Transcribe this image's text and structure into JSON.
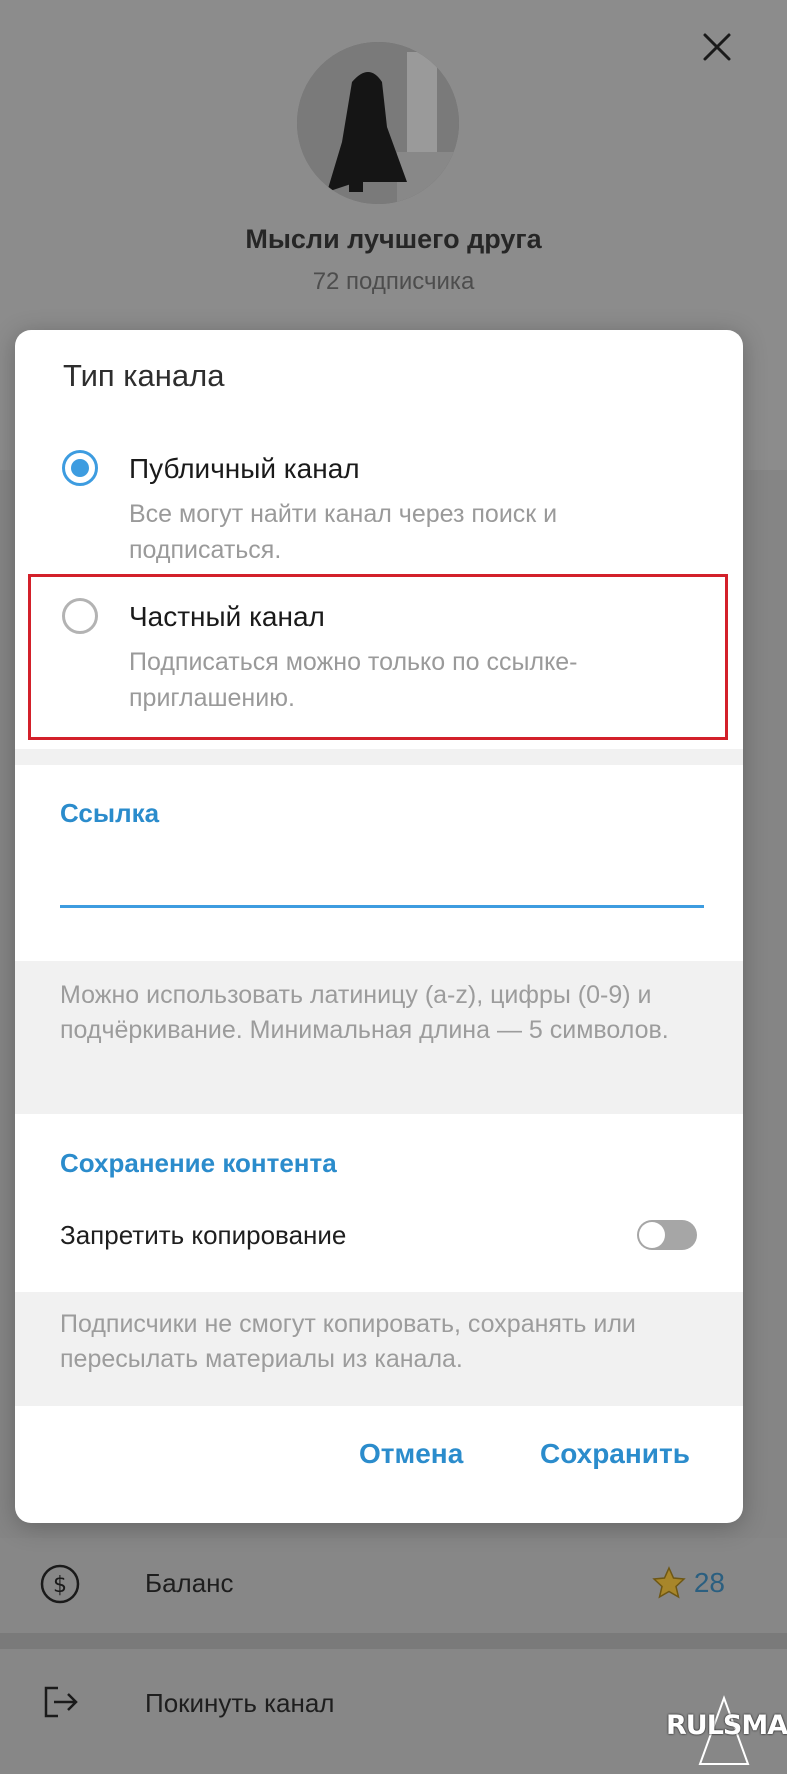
{
  "background": {
    "channel_name": "Мысли лучшего друга",
    "subscribers": "72 подписчика",
    "balance_label": "Баланс",
    "balance_value": "28",
    "leave_label": "Покинуть канал",
    "watermark": "RULSMART"
  },
  "modal": {
    "title": "Тип канала",
    "options": [
      {
        "label": "Публичный канал",
        "description": "Все могут найти канал через поиск и подписаться.",
        "selected": true
      },
      {
        "label": "Частный канал",
        "description": "Подписаться можно только по ссылке-приглашению.",
        "selected": false
      }
    ],
    "link_section": {
      "heading": "Ссылка",
      "value": "",
      "help": "Можно использовать латиницу (a-z), цифры (0-9) и подчёркивание. Минимальная длина — 5 символов."
    },
    "content_section": {
      "heading": "Сохранение контента",
      "toggle_label": "Запретить копирование",
      "toggle_on": false,
      "help": "Подписчики не смогут копировать, сохранять или пересылать материалы из канала."
    },
    "buttons": {
      "cancel": "Отмена",
      "save": "Сохранить"
    }
  },
  "colors": {
    "accent": "#2b8ccc",
    "radio_active": "#3d9ce0",
    "highlight_border": "#d3202a"
  },
  "icons": [
    "close-icon",
    "avatar",
    "dollar-icon",
    "star-icon",
    "exit-icon"
  ]
}
